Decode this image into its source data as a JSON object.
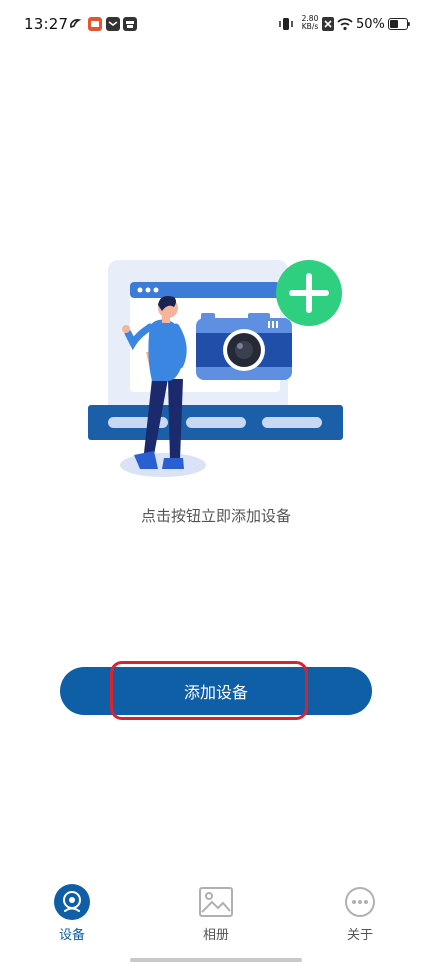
{
  "status_bar": {
    "time": "13:27",
    "net_speed_value": "2.80",
    "net_speed_unit": "KB/s",
    "battery_percent": "50%"
  },
  "main": {
    "empty_hint": "点击按钮立即添加设备",
    "add_button_label": "添加设备"
  },
  "bottom_nav": {
    "items": [
      {
        "label": "设备",
        "icon": "camera-icon",
        "active": true
      },
      {
        "label": "相册",
        "icon": "image-icon",
        "active": false
      },
      {
        "label": "关于",
        "icon": "more-icon",
        "active": false
      }
    ]
  },
  "colors": {
    "primary": "#0f5fa6",
    "accent_green": "#2ecf7e",
    "highlight_red": "#d9232e",
    "inactive": "#b0b0b0"
  }
}
